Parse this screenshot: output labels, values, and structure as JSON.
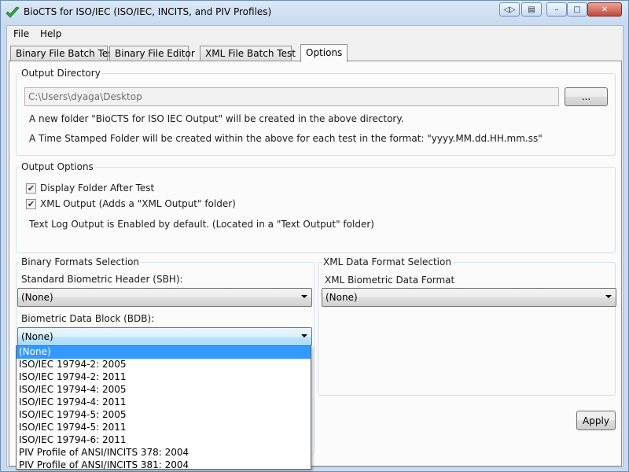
{
  "window": {
    "title": "BioCTS for ISO/IEC (ISO/IEC, INCITS, and PIV Profiles)",
    "controls": {
      "restore_symbol": "◁▷",
      "pin_symbol": "▤",
      "minimize_symbol": "–",
      "maximize_symbol": "□",
      "close_symbol": "✕"
    }
  },
  "menu": [
    "File",
    "Help"
  ],
  "tabs": [
    "Binary File Batch Test",
    "Binary File Editor",
    "XML File Batch Test",
    "Options"
  ],
  "active_tab": "Options",
  "output_directory": {
    "label": "Output Directory",
    "path": "C:\\Users\\dyaga\\Desktop",
    "browse_label": "...",
    "note1": "A new folder \"BioCTS for ISO IEC Output\" will be created in the above directory.",
    "note2": "A Time Stamped Folder will be created within the above for each test in the format: \"yyyy.MM.dd.HH.mm.ss\""
  },
  "output_options": {
    "label": "Output Options",
    "display_folder": {
      "label": "Display Folder After Test",
      "checked": true
    },
    "xml_output": {
      "label": "XML Output (Adds a \"XML Output\" folder)",
      "checked": true
    },
    "note": "Text Log Output is Enabled by default. (Located in a \"Text Output\" folder)",
    "check_glyph": "✔"
  },
  "binary_formats": {
    "label": "Binary Formats Selection",
    "sbh_label": "Standard Biometric Header (SBH):",
    "sbh_value": "(None)",
    "bdb_label": "Biometric Data Block (BDB):",
    "bdb_value": "(None)",
    "bdb_options": [
      "(None)",
      "ISO/IEC 19794-2: 2005",
      "ISO/IEC 19794-2: 2011",
      "ISO/IEC 19794-4: 2005",
      "ISO/IEC 19794-4: 2011",
      "ISO/IEC 19794-5: 2005",
      "ISO/IEC 19794-5: 2011",
      "ISO/IEC 19794-6: 2011",
      "PIV Profile of ANSI/INCITS 378: 2004",
      "PIV Profile of ANSI/INCITS 381: 2004"
    ],
    "selected_index": 0
  },
  "xml_formats": {
    "label": "XML Data Format Selection",
    "format_label": "XML Biometric Data Format",
    "format_value": "(None)"
  },
  "apply_label": "Apply",
  "colors": {
    "selection": "#3399ff",
    "title_bar": "#cfe0f2",
    "close_button": "#c3473a"
  }
}
